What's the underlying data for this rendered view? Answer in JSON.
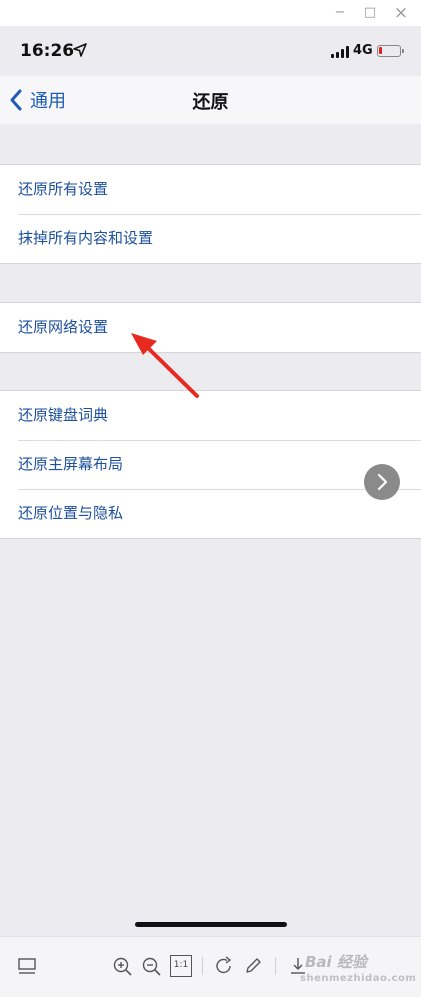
{
  "window": {
    "minimize_glyph": "−",
    "maximize_glyph": "□",
    "close_glyph": "×"
  },
  "status_bar": {
    "time": "16:26",
    "network": "4G",
    "battery_level_fraction": 0.15,
    "battery_color": "#e02020"
  },
  "nav": {
    "back_label": "通用",
    "title": "还原"
  },
  "groups": [
    {
      "items": [
        {
          "label": "还原所有设置"
        },
        {
          "label": "抹掉所有内容和设置"
        }
      ]
    },
    {
      "items": [
        {
          "label": "还原网络设置"
        }
      ]
    },
    {
      "items": [
        {
          "label": "还原键盘词典"
        },
        {
          "label": "还原主屏幕布局"
        },
        {
          "label": "还原位置与隐私"
        }
      ]
    }
  ],
  "annotation": {
    "color": "#e8291f",
    "points_to": "还原网络设置"
  },
  "toolbar": {
    "icons": [
      "thumbnail-icon",
      "zoom-in-icon",
      "zoom-out-icon",
      "actual-size-icon",
      "rotate-icon",
      "edit-icon",
      "download-icon"
    ],
    "actual_size_label": "1:1",
    "watermark": "Bai 经验",
    "watermark_url": "shenmezhidao.com"
  },
  "colors": {
    "link_blue": "#1c4f9e",
    "background_gray": "#ececf0"
  }
}
